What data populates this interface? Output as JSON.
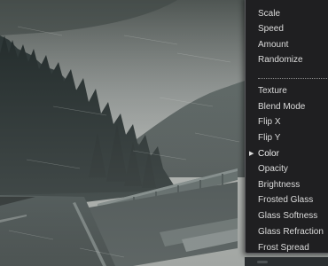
{
  "menu": {
    "items_top": [
      {
        "label": "Scale"
      },
      {
        "label": "Speed"
      },
      {
        "label": "Amount"
      },
      {
        "label": "Randomize"
      }
    ],
    "items_bottom": [
      {
        "label": "Texture"
      },
      {
        "label": "Blend Mode"
      },
      {
        "label": "Flip X"
      },
      {
        "label": "Flip Y"
      },
      {
        "label": "Color",
        "active": true
      },
      {
        "label": "Opacity"
      },
      {
        "label": "Brightness"
      },
      {
        "label": "Frosted Glass"
      },
      {
        "label": "Glass Softness"
      },
      {
        "label": "Glass Refraction"
      },
      {
        "label": "Frost Spread"
      }
    ]
  },
  "colors": {
    "menu_bg": "#1f1f21",
    "menu_border": "#5b5b5f",
    "menu_text": "#dcdcdc"
  }
}
